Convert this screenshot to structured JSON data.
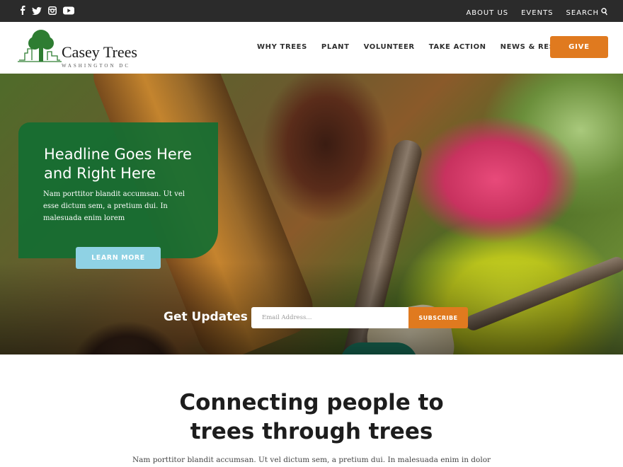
{
  "topbar": {
    "social_icons": [
      "facebook-icon",
      "twitter-icon",
      "instagram-icon",
      "youtube-icon"
    ],
    "links": [
      "ABOUT US",
      "EVENTS"
    ],
    "search_label": "SEARCH"
  },
  "header": {
    "logo_name": "Casey Trees",
    "logo_sub": "WASHINGTON DC",
    "nav": [
      "WHY TREES",
      "PLANT",
      "VOLUNTEER",
      "TAKE ACTION",
      "NEWS & RESOURCES"
    ],
    "give_label": "GIVE"
  },
  "hero": {
    "headline": "Headline Goes Here and Right Here",
    "body": "Nam porttitor blandit accumsan. Ut vel esse dictum sem, a pretium dui. In malesuada enim lorem",
    "cta_label": "LEARN MORE",
    "updates_label": "Get Updates",
    "email_placeholder": "Email Address...",
    "subscribe_label": "SUBSCRIBE"
  },
  "intro": {
    "title_line1": "Connecting people to",
    "title_line2": "trees through trees",
    "body": "Nam porttitor blandit accumsan. Ut vel dictum sem, a pretium dui. In malesuada enim in dolor"
  },
  "colors": {
    "topbar": "#2b2b2b",
    "accent_orange": "#e07a1f",
    "card_green": "#146e32",
    "cta_blue": "#8fd2e4"
  }
}
